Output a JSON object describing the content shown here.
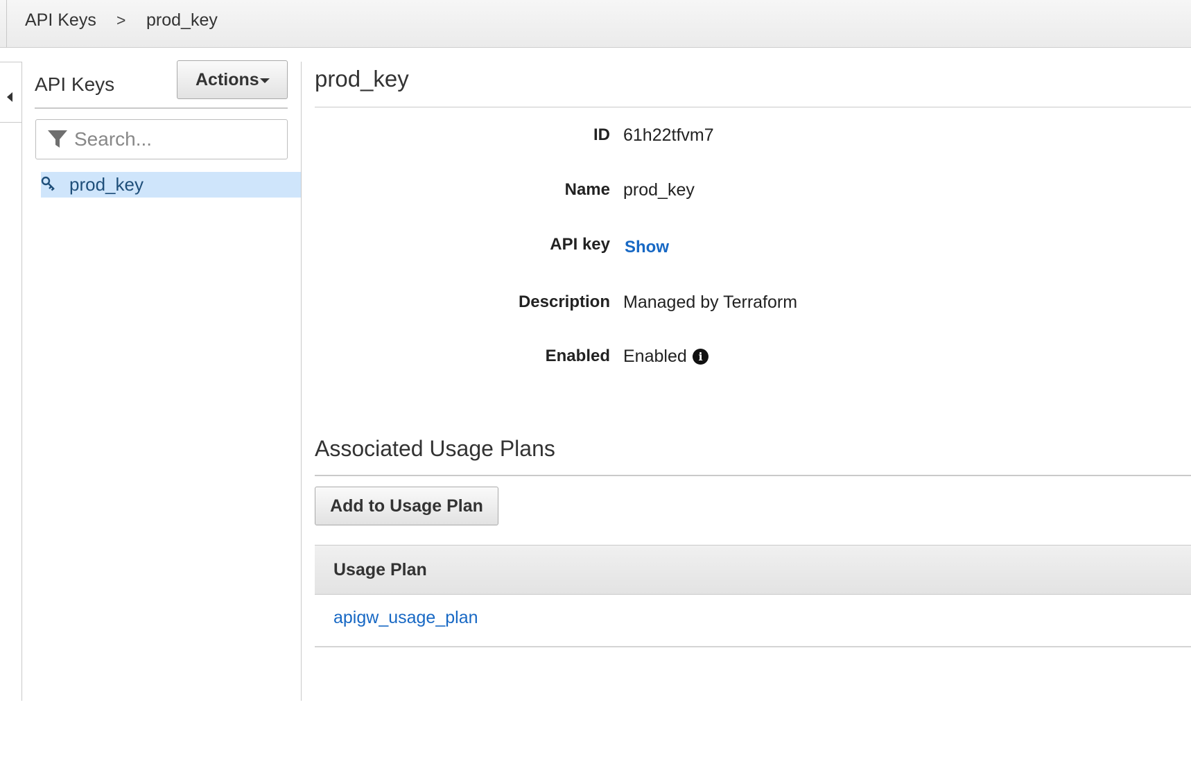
{
  "breadcrumb": {
    "root": "API Keys",
    "separator": ">",
    "current": "prod_key"
  },
  "sidebar": {
    "title": "API Keys",
    "actions_label": "Actions",
    "search_placeholder": "Search...",
    "items": [
      {
        "label": "prod_key",
        "icon": "key-icon",
        "selected": true
      }
    ]
  },
  "detail": {
    "title": "prod_key",
    "fields": {
      "id": {
        "label": "ID",
        "value": "61h22tfvm7"
      },
      "name": {
        "label": "Name",
        "value": "prod_key"
      },
      "api_key": {
        "label": "API key",
        "link": "Show"
      },
      "description": {
        "label": "Description",
        "value": "Managed by Terraform"
      },
      "enabled": {
        "label": "Enabled",
        "value": "Enabled",
        "info_icon": "info-icon"
      }
    }
  },
  "usage_plans": {
    "title": "Associated Usage Plans",
    "add_button_label": "Add to Usage Plan",
    "table": {
      "header": "Usage Plan",
      "rows": [
        "apigw_usage_plan"
      ]
    }
  },
  "colors": {
    "link": "#1768c4",
    "selected_row": "#cfe5fb",
    "border": "#c9c9c9"
  }
}
